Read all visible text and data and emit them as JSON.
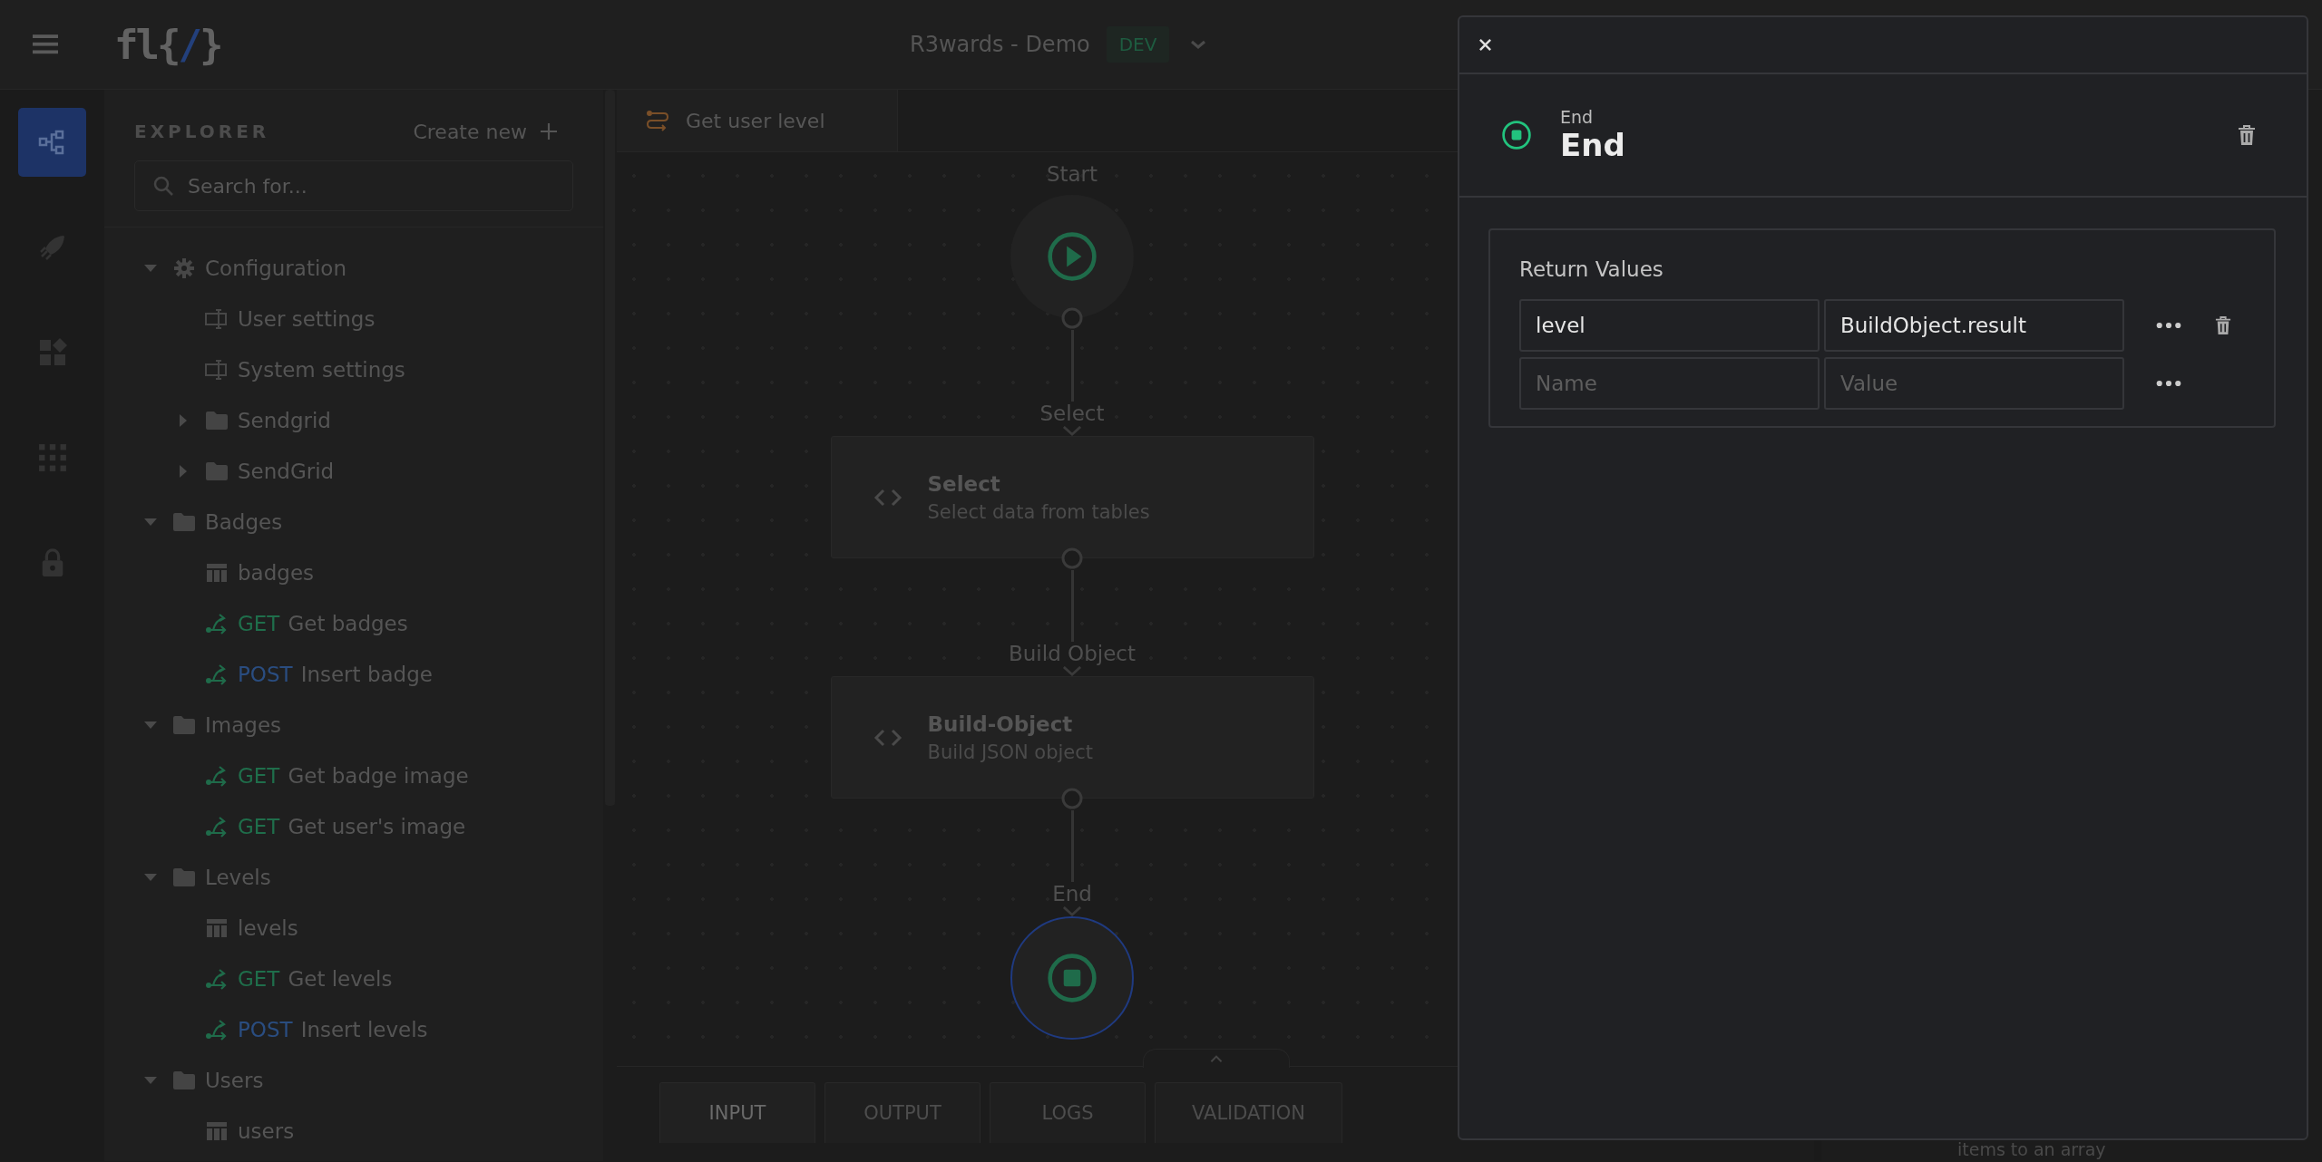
{
  "topbar": {
    "logo": [
      "fl{",
      "/",
      "}"
    ],
    "project": "R3wards - Demo",
    "env": "DEV"
  },
  "rail": [
    {
      "kind": "flow",
      "selected": true
    },
    {
      "kind": "rocket",
      "selected": false
    },
    {
      "kind": "widgets",
      "selected": false
    },
    {
      "kind": "apps",
      "selected": false
    },
    {
      "kind": "lock",
      "selected": false
    }
  ],
  "explorer": {
    "title": "EXPLORER",
    "create": "Create new",
    "search": {
      "placeholder": "Search for..."
    },
    "tree": [
      {
        "label": "Configuration",
        "kind": "settings",
        "expanded": true,
        "children": [
          {
            "label": "User settings",
            "kind": "config"
          },
          {
            "label": "System settings",
            "kind": "config"
          },
          {
            "label": "Sendgrid",
            "kind": "folder",
            "expanded": false
          },
          {
            "label": "SendGrid",
            "kind": "folder",
            "expanded": false
          }
        ]
      },
      {
        "label": "Badges",
        "kind": "folder",
        "expanded": true,
        "children": [
          {
            "label": "badges",
            "kind": "table"
          },
          {
            "label": "Get badges",
            "kind": "endpoint",
            "method": "GET"
          },
          {
            "label": "Insert badge",
            "kind": "endpoint",
            "method": "POST"
          }
        ]
      },
      {
        "label": "Images",
        "kind": "folder",
        "expanded": true,
        "children": [
          {
            "label": "Get badge image",
            "kind": "endpoint",
            "method": "GET"
          },
          {
            "label": "Get user's image",
            "kind": "endpoint",
            "method": "GET"
          }
        ]
      },
      {
        "label": "Levels",
        "kind": "folder",
        "expanded": true,
        "children": [
          {
            "label": "levels",
            "kind": "table"
          },
          {
            "label": "Get levels",
            "kind": "endpoint",
            "method": "GET"
          },
          {
            "label": "Insert levels",
            "kind": "endpoint",
            "method": "POST"
          }
        ]
      },
      {
        "label": "Users",
        "kind": "folder",
        "expanded": true,
        "children": [
          {
            "label": "users",
            "kind": "table"
          }
        ]
      }
    ]
  },
  "canvas": {
    "tab": "Get user level",
    "nodes": [
      {
        "kind": "start",
        "label": "Start",
        "selected": false
      },
      {
        "kind": "step",
        "label": "Select",
        "title": "Select",
        "subtitle": "Select data from tables",
        "selected": false
      },
      {
        "kind": "step",
        "label": "Build Object",
        "title": "Build-Object",
        "subtitle": "Build JSON object",
        "selected": false
      },
      {
        "kind": "end",
        "label": "End",
        "selected": true
      }
    ],
    "bottom_tabs": [
      {
        "label": "INPUT",
        "selected": true
      },
      {
        "label": "OUTPUT",
        "selected": false
      },
      {
        "label": "LOGS",
        "selected": false
      },
      {
        "label": "VALIDATION",
        "selected": false
      }
    ]
  },
  "side_panel": {
    "text": "items to an array"
  },
  "drawer": {
    "kind": "end",
    "type": "End",
    "title": "End",
    "section": "Return Values",
    "rows": [
      {
        "name": {
          "value": "level"
        },
        "value": {
          "value": "BuildObject.result"
        },
        "removable": true
      },
      {
        "name": {
          "placeholder": "Name"
        },
        "value": {
          "placeholder": "Value"
        },
        "removable": false
      }
    ]
  }
}
